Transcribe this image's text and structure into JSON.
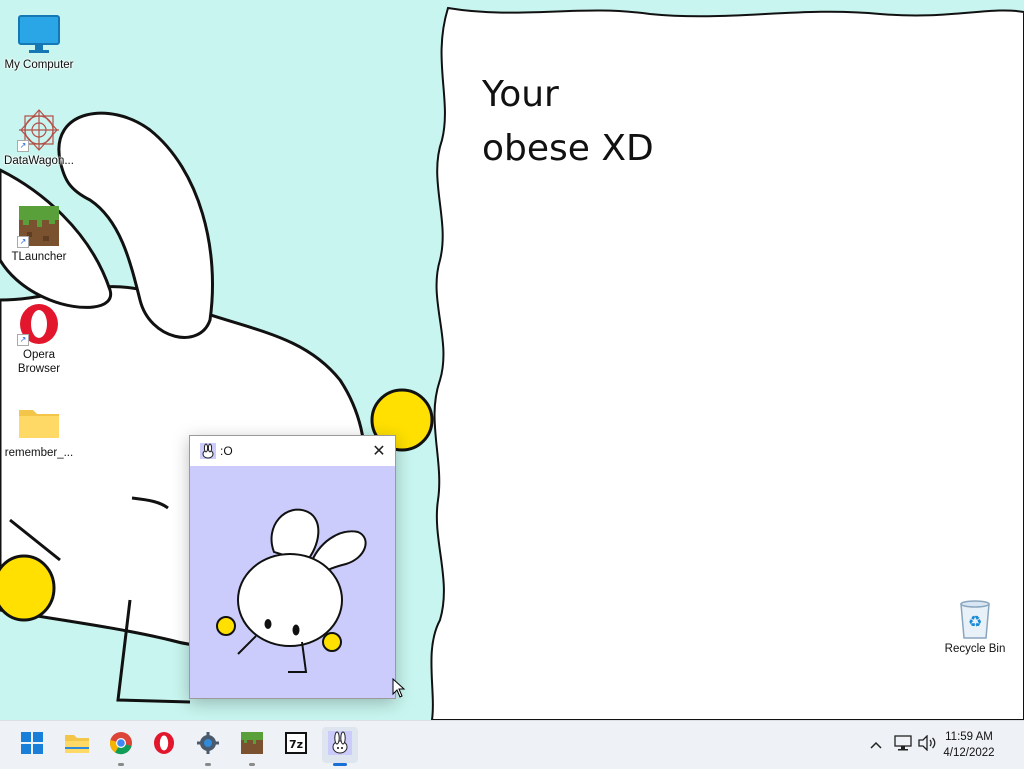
{
  "desktop": {
    "icons": [
      {
        "label": "My Computer",
        "icon": "monitor-icon"
      },
      {
        "label": "DataWagon...",
        "icon": "web-pattern-icon"
      },
      {
        "label": "TLauncher",
        "icon": "grass-block-icon"
      },
      {
        "label": "Opera Browser",
        "icon": "opera-icon"
      },
      {
        "label": "remember_...",
        "icon": "folder-icon"
      },
      {
        "label": "Recycle Bin",
        "icon": "recycle-bin-icon"
      }
    ],
    "note": {
      "line1": "Your",
      "line2": "obese XD"
    }
  },
  "window": {
    "title": ":O",
    "close_icon": "close-icon"
  },
  "taskbar": {
    "pinned": [
      {
        "name": "start-button",
        "icon": "windows-logo-icon"
      },
      {
        "name": "file-explorer",
        "icon": "folder-icon"
      },
      {
        "name": "chrome",
        "icon": "chrome-icon"
      },
      {
        "name": "opera",
        "icon": "opera-icon"
      },
      {
        "name": "settings",
        "icon": "gear-icon"
      },
      {
        "name": "tlauncher",
        "icon": "grass-block-icon"
      },
      {
        "name": "7-zip",
        "icon": "7zip-icon"
      },
      {
        "name": "bunny-app",
        "icon": "bunny-icon"
      }
    ],
    "tray_icons": [
      "chevron-up-icon",
      "network-icon",
      "volume-icon"
    ],
    "clock": {
      "time": "11:59 AM",
      "date": "4/12/2022"
    }
  },
  "colors": {
    "wallpaper": "#c8f5ef",
    "window_content": "#cbccfb",
    "taskbar": "#eef1f5",
    "accent": "#1a6fd6"
  }
}
